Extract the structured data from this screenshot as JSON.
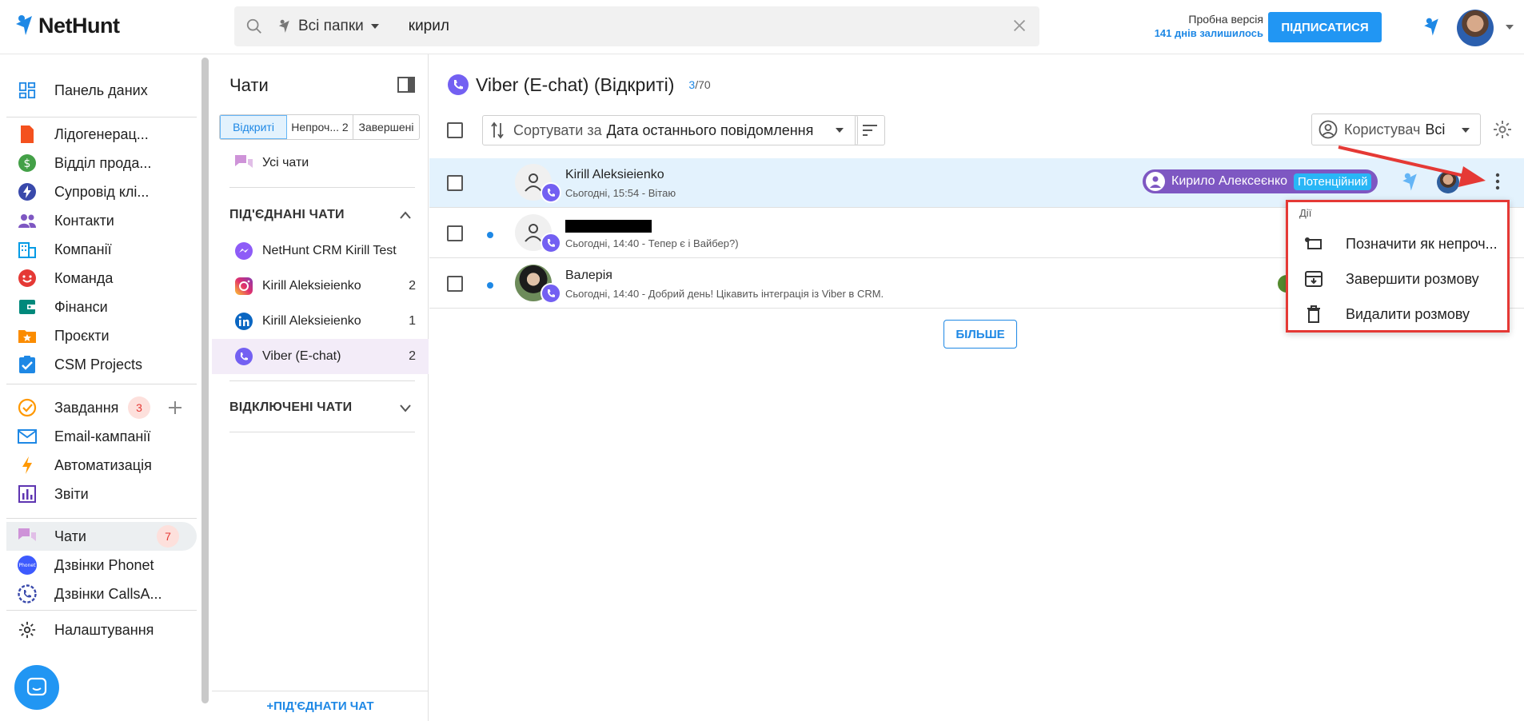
{
  "brand": {
    "name": "NetHunt",
    "color": "#1e88e5"
  },
  "search": {
    "folder_label": "Всі папки",
    "query": "кирил"
  },
  "trial": {
    "label": "Пробна версія",
    "days_left": "141 днів залишилось",
    "subscribe": "ПІДПИСАТИСЯ"
  },
  "nav": {
    "dashboard": "Панель даних",
    "folders": [
      "Лідогенерац...",
      "Відділ прода...",
      "Супровід клі...",
      "Контакти",
      "Компанії",
      "Команда",
      "Фінанси",
      "Проєкти",
      "CSM Projects"
    ],
    "tasks": "Завдання",
    "tasks_count": "3",
    "email": "Email-кампанії",
    "automation": "Автоматизація",
    "reports": "Звіти",
    "chats": "Чати",
    "chats_count": "7",
    "phonet": "Дзвінки Phonet",
    "callsapp": "Дзвінки CallsA...",
    "settings": "Налаштування",
    "phonet_icon_text": "Phonet"
  },
  "chatpanel": {
    "title": "Чати",
    "tabs": [
      "Відкриті",
      "Непроч... 2",
      "Завершені"
    ],
    "all_chats": "Усі чати",
    "connected_title": "ПІД'ЄДНАНІ ЧАТИ",
    "connected": [
      {
        "name": "NetHunt CRM Kirill Test",
        "count": "",
        "icon": "messenger-icon"
      },
      {
        "name": "Kirill Aleksieienko",
        "count": "2",
        "icon": "instagram-icon"
      },
      {
        "name": "Kirill Aleksieienko",
        "count": "1",
        "icon": "linkedin-icon"
      },
      {
        "name": "Viber (E-chat)",
        "count": "2",
        "icon": "viber-icon"
      }
    ],
    "disconnected_title": "ВІДКЛЮЧЕНІ ЧАТИ",
    "connect_button": "+ПІД'ЄДНАТИ ЧАТ"
  },
  "main": {
    "title": "Viber (E-chat) (Відкриті)",
    "count_current": "3",
    "count_total": "/70",
    "sort_label": "Сортувати за",
    "sort_value": "Дата останнього повідомлення",
    "user_label": "Користувач",
    "user_value": "Всі",
    "rows": [
      {
        "name": "Kirill Aleksieienko",
        "preview": "Сьогодні, 15:54 - Вітаю",
        "contact": "Кирило Алексеєнко",
        "status": "Потенційний"
      },
      {
        "name": "",
        "preview": "Сьогодні, 14:40 - Тепер є і Вайбер?)"
      },
      {
        "name": "Валерія",
        "preview": "Сьогодні, 14:40 - Добрий день! Цікавить інтеграція із Viber в CRM."
      }
    ],
    "more_button": "БІЛЬШЕ"
  },
  "menu": {
    "header": "Дії",
    "items": [
      "Позначити як непроч...",
      "Завершити розмову",
      "Видалити розмову"
    ]
  }
}
